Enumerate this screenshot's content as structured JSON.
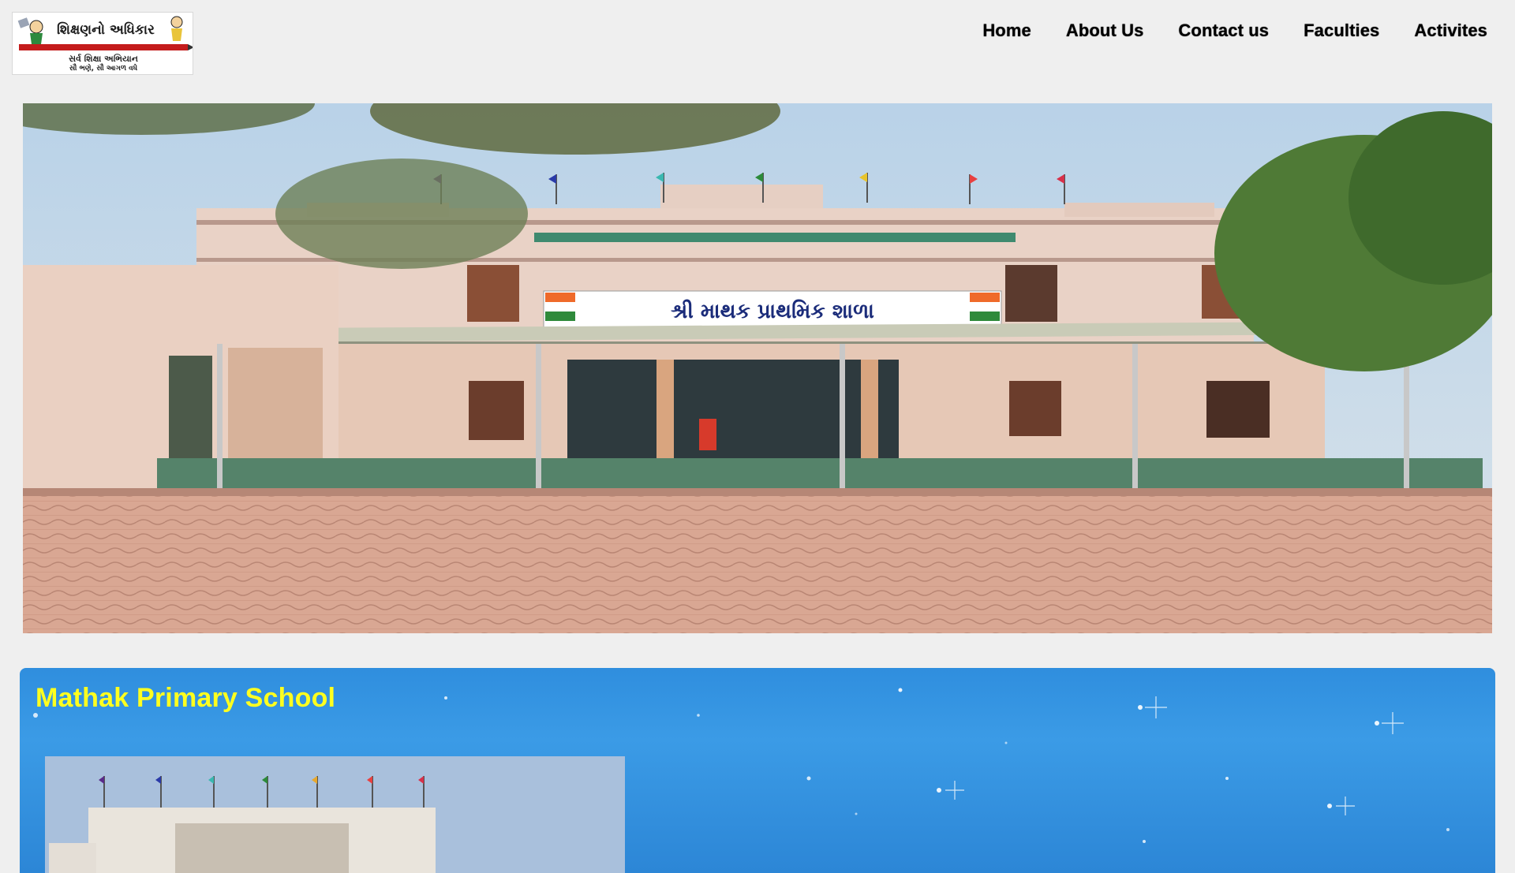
{
  "logo": {
    "title": "શિક્ષણનો અધિકાર",
    "subtitle": "સર્વ શિક્ષા અભિયાન",
    "tagline": "સૌ ભણે, સૌ આગળ વધે"
  },
  "nav": {
    "items": [
      "Home",
      "About Us",
      "Contact us",
      "Faculties",
      "Activites"
    ]
  },
  "hero": {
    "sign_text": "શ્રી માથક પ્રાથમિક શાળા"
  },
  "info": {
    "title": "Mathak Primary School"
  },
  "colors": {
    "page_bg": "#efefef",
    "nav_text": "#000000",
    "info_bg": "#3b9be6",
    "info_title": "#ffff1f"
  }
}
